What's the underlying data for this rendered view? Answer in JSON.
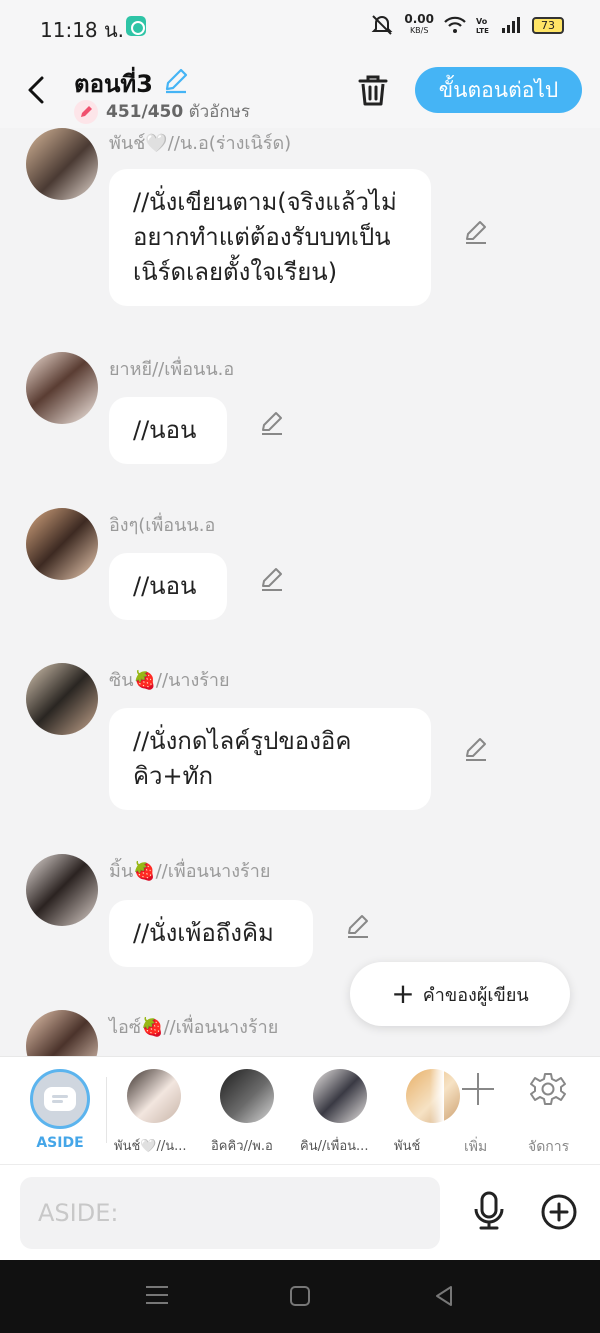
{
  "status": {
    "time": "11:18 น.",
    "net_speed": "0.00",
    "net_unit": "KB/S",
    "battery": "73"
  },
  "header": {
    "title": "ตอนที่3",
    "char_count": "451/450",
    "char_unit": "ตัวอักษร",
    "next_label": "ขั้นตอนต่อไป"
  },
  "messages": [
    {
      "name": "พันช์🤍//น.อ(ร่างเนิร์ด)",
      "text": "//นั่งเขียนตาม(จริงแล้วไม่อยากทำแต่ต้องรับบทเป็นเนิร์ดเลยตั้งใจเรียน)"
    },
    {
      "name": "ยาหยี//เพื่อนน.อ",
      "text": "//นอน"
    },
    {
      "name": "อิงๆ(เพื่อนน.อ",
      "text": "//นอน"
    },
    {
      "name": "ซิน🍓//นางร้าย",
      "text": "//นั่งกดไลค์รูปของอิคคิว+ทัก"
    },
    {
      "name": "มิ้น🍓//เพื่อนนางร้าย",
      "text": "//นั่งเพ้อถึงคิม"
    },
    {
      "name": "ไอซ์🍓//เพื่อนนางร้าย",
      "text": ""
    }
  ],
  "float_button": {
    "label": "คำของผู้เขียน"
  },
  "characters": {
    "aside_label": "ASIDE",
    "items": [
      {
        "name": "พันช์🤍//น..."
      },
      {
        "name": "อิคคิว//พ.อ"
      },
      {
        "name": "คิน//เพื่อน..."
      },
      {
        "name": "พันช์"
      }
    ],
    "add_label": "เพิ่ม",
    "manage_label": "จัดการ"
  },
  "input": {
    "placeholder": "ASIDE:"
  },
  "colors": {
    "accent": "#45b4f5",
    "background": "#f3f3f4",
    "bubble": "#ffffff",
    "name_text": "#9a9a9a"
  }
}
